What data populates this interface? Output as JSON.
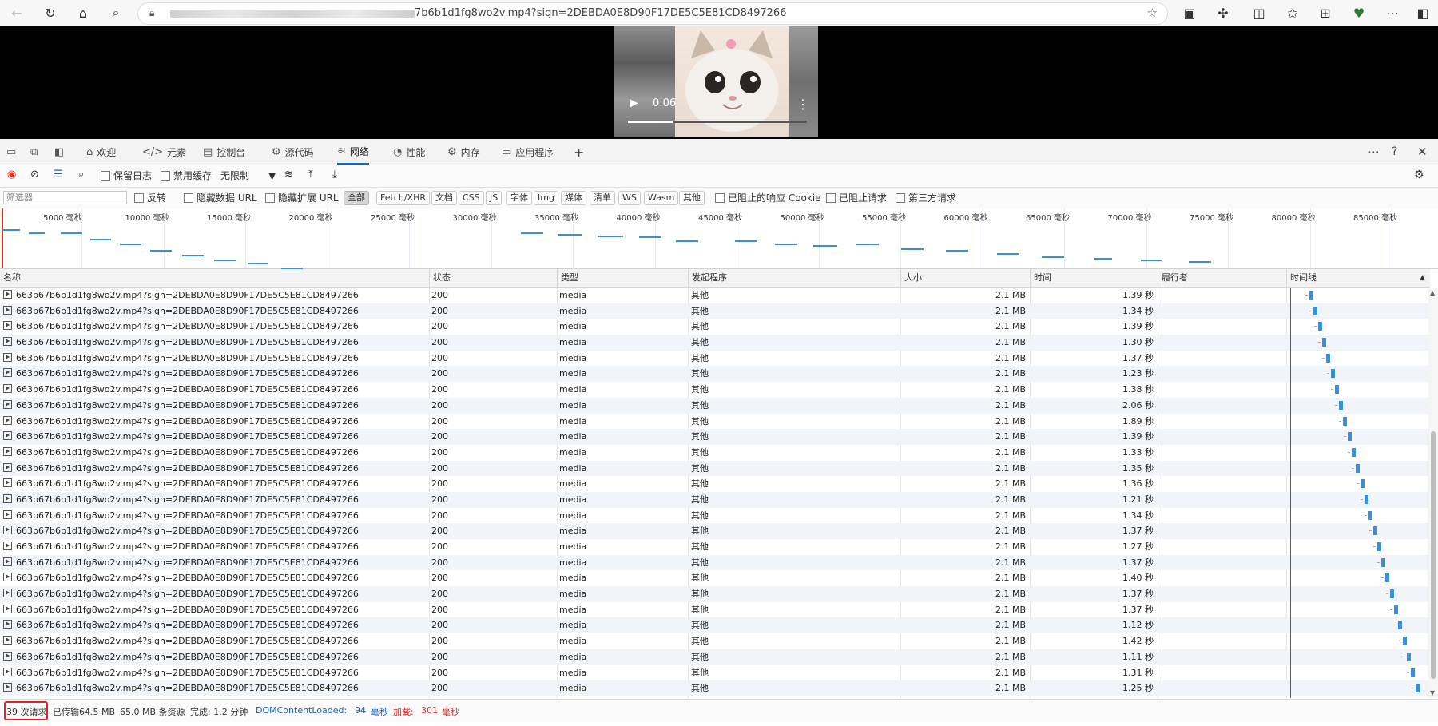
{
  "browser": {
    "url_visible": "7b6b1d1fg8wo2v.mp4?sign=2DEBDA0E8D90F17DE5C5E81CD8497266",
    "icons": [
      "back-icon",
      "refresh-icon",
      "home-icon",
      "search-icon",
      "lock-icon",
      "star-icon",
      "collections-icon",
      "extensions-icon",
      "split-screen-icon",
      "favorites-icon",
      "collections-add-icon",
      "browser-essentials-icon",
      "more-icon",
      "sidebar-toggle-icon"
    ]
  },
  "video": {
    "current_time": "0:06",
    "progress_percent": 25
  },
  "devtools": {
    "tabs": [
      "欢迎",
      "元素",
      "控制台",
      "源代码",
      "网络",
      "性能",
      "内存",
      "应用程序"
    ],
    "active_tab": "网络",
    "toolbar": {
      "preserve_log": "保留日志",
      "disable_cache": "禁用缓存",
      "throttle": "无限制"
    },
    "filter": {
      "placeholder": "筛选器",
      "invert": "反转",
      "hide_data_url": "隐藏数据 URL",
      "hide_ext_url": "隐藏扩展 URL",
      "types": [
        "全部",
        "Fetch/XHR",
        "文档",
        "CSS",
        "JS",
        "字体",
        "Img",
        "媒体",
        "清单",
        "WS",
        "Wasm",
        "其他"
      ],
      "blocked_cookies": "已阻止的响应 Cookie",
      "blocked_requests": "已阻止请求",
      "third_party": "第三方请求"
    },
    "overview_ticks": [
      "5000 毫秒",
      "10000 毫秒",
      "15000 毫秒",
      "20000 毫秒",
      "25000 毫秒",
      "30000 毫秒",
      "35000 毫秒",
      "40000 毫秒",
      "45000 毫秒",
      "50000 毫秒",
      "55000 毫秒",
      "60000 毫秒",
      "65000 毫秒",
      "70000 毫秒",
      "75000 毫秒",
      "80000 毫秒",
      "85000 毫秒"
    ],
    "columns": {
      "name": "名称",
      "status": "状态",
      "type": "类型",
      "initiator": "发起程序",
      "size": "大小",
      "time": "时间",
      "fulfilled": "履行者",
      "waterfall": "时间线"
    },
    "request_name": "663b67b6b1d1fg8wo2v.mp4?sign=2DEBDA0E8D90F17DE5C5E81CD8497266",
    "rows": [
      {
        "status": "200",
        "type": "media",
        "initiator": "其他",
        "size": "2.1 MB",
        "time": "1.39 秒"
      },
      {
        "status": "200",
        "type": "media",
        "initiator": "其他",
        "size": "2.1 MB",
        "time": "1.34 秒"
      },
      {
        "status": "200",
        "type": "media",
        "initiator": "其他",
        "size": "2.1 MB",
        "time": "1.39 秒"
      },
      {
        "status": "200",
        "type": "media",
        "initiator": "其他",
        "size": "2.1 MB",
        "time": "1.30 秒"
      },
      {
        "status": "200",
        "type": "media",
        "initiator": "其他",
        "size": "2.1 MB",
        "time": "1.37 秒"
      },
      {
        "status": "200",
        "type": "media",
        "initiator": "其他",
        "size": "2.1 MB",
        "time": "1.23 秒"
      },
      {
        "status": "200",
        "type": "media",
        "initiator": "其他",
        "size": "2.1 MB",
        "time": "1.38 秒"
      },
      {
        "status": "200",
        "type": "media",
        "initiator": "其他",
        "size": "2.1 MB",
        "time": "2.06 秒"
      },
      {
        "status": "200",
        "type": "media",
        "initiator": "其他",
        "size": "2.1 MB",
        "time": "1.89 秒"
      },
      {
        "status": "200",
        "type": "media",
        "initiator": "其他",
        "size": "2.1 MB",
        "time": "1.39 秒"
      },
      {
        "status": "200",
        "type": "media",
        "initiator": "其他",
        "size": "2.1 MB",
        "time": "1.33 秒"
      },
      {
        "status": "200",
        "type": "media",
        "initiator": "其他",
        "size": "2.1 MB",
        "time": "1.35 秒"
      },
      {
        "status": "200",
        "type": "media",
        "initiator": "其他",
        "size": "2.1 MB",
        "time": "1.36 秒"
      },
      {
        "status": "200",
        "type": "media",
        "initiator": "其他",
        "size": "2.1 MB",
        "time": "1.21 秒"
      },
      {
        "status": "200",
        "type": "media",
        "initiator": "其他",
        "size": "2.1 MB",
        "time": "1.34 秒"
      },
      {
        "status": "200",
        "type": "media",
        "initiator": "其他",
        "size": "2.1 MB",
        "time": "1.37 秒"
      },
      {
        "status": "200",
        "type": "media",
        "initiator": "其他",
        "size": "2.1 MB",
        "time": "1.27 秒"
      },
      {
        "status": "200",
        "type": "media",
        "initiator": "其他",
        "size": "2.1 MB",
        "time": "1.37 秒"
      },
      {
        "status": "200",
        "type": "media",
        "initiator": "其他",
        "size": "2.1 MB",
        "time": "1.40 秒"
      },
      {
        "status": "200",
        "type": "media",
        "initiator": "其他",
        "size": "2.1 MB",
        "time": "1.37 秒"
      },
      {
        "status": "200",
        "type": "media",
        "initiator": "其他",
        "size": "2.1 MB",
        "time": "1.37 秒"
      },
      {
        "status": "200",
        "type": "media",
        "initiator": "其他",
        "size": "2.1 MB",
        "time": "1.12 秒"
      },
      {
        "status": "200",
        "type": "media",
        "initiator": "其他",
        "size": "2.1 MB",
        "time": "1.42 秒"
      },
      {
        "status": "200",
        "type": "media",
        "initiator": "其他",
        "size": "2.1 MB",
        "time": "1.11 秒"
      },
      {
        "status": "200",
        "type": "media",
        "initiator": "其他",
        "size": "2.1 MB",
        "time": "1.31 秒"
      },
      {
        "status": "200",
        "type": "media",
        "initiator": "其他",
        "size": "2.1 MB",
        "time": "1.25 秒"
      }
    ],
    "status": {
      "requests": "39 次请求",
      "transferred": "已传输64.5 MB",
      "resources": "65.0 MB 条资源",
      "finish": "完成: 1.2 分钟",
      "dcl_label": "DOMContentLoaded:",
      "dcl_value": "94",
      "dcl_unit": "毫秒",
      "load_label": "加载:",
      "load_value": "301",
      "load_unit": "毫秒"
    },
    "colors": {
      "accent": "#0f6cbd",
      "bar": "#3a8fd8",
      "highlight": "#e3232a"
    }
  }
}
